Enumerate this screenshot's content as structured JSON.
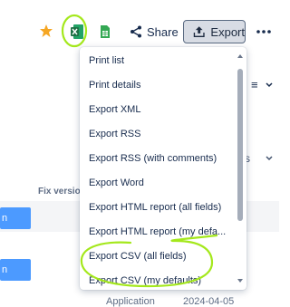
{
  "toolbar": {
    "share_label": "Share",
    "export_label": "Export",
    "icons": [
      "star-icon",
      "excel-icon",
      "spreadsheet-icon",
      "share-icon",
      "export-icon",
      "more-icon"
    ]
  },
  "background": {
    "column_header": "Fix versions",
    "row1_block": "n",
    "row2_block": "n",
    "bottom_left": "Application",
    "bottom_right": "2024-04-05",
    "list_ctl": "≡",
    "mid_ctl": "s"
  },
  "menu": {
    "items": [
      {
        "label": "Print list"
      },
      {
        "label": "Print details"
      },
      {
        "label": "Export XML"
      },
      {
        "label": "Export RSS"
      },
      {
        "label": "Export RSS (with comments)"
      },
      {
        "label": "Export Word"
      },
      {
        "label": "Export HTML report (all fields)"
      },
      {
        "label": "Export HTML report (my defa..."
      },
      {
        "label": "Export CSV (all fields)"
      },
      {
        "label": "Export CSV (my defaults)"
      }
    ]
  },
  "colors": {
    "accent": "#4c9aff",
    "annotation": "#a4e81c",
    "star": "#f5a623",
    "excel": "#1e7145"
  }
}
